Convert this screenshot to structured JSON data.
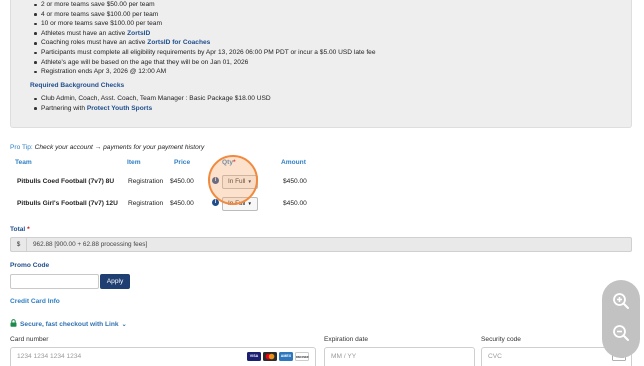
{
  "discounts": [
    {
      "text": "2 or more teams save $50.00 per team"
    },
    {
      "text": "4 or more teams save $100.00 per team"
    },
    {
      "text": "10 or more teams save $100.00 per team"
    }
  ],
  "requirements": {
    "athletes": {
      "text": "Athletes must have an active ",
      "link": "ZortsID"
    },
    "coaching": {
      "text": "Coaching roles must have an active ",
      "link": "ZortsID for Coaches"
    },
    "eligibility": "Participants must complete all eligibility requirements by Apr 13, 2026 06:00 PM PDT or incur a $5.00 USD late fee",
    "age": "Athlete's age will be based on the age that they will be on Jan 01, 2026",
    "reg_ends": "Registration ends Apr 3, 2026 @ 12:00 AM"
  },
  "background_checks": {
    "heading": "Required Background Checks",
    "package": "Club Admin, Coach, Asst. Coach, Team Manager : Basic Package $18.00 USD",
    "partner_text": "Partnering with ",
    "partner_link": "Protect Youth Sports"
  },
  "pro_tip": {
    "label": "Pro Tip:",
    "text": "Check your account → payments for your payment history"
  },
  "table": {
    "headers": {
      "team": "Team",
      "item": "Item",
      "price": "Price",
      "qty": "Qty",
      "qty_star": "*",
      "amount": "Amount"
    },
    "rows": [
      {
        "team": "Pitbulls Coed Football (7v7) 8U",
        "item": "Registration",
        "price": "$450.00",
        "qty": "In Full",
        "amount": "$450.00"
      },
      {
        "team": "Pitbulls Girl's Football (7v7) 12U",
        "item": "Registration",
        "price": "$450.00",
        "qty": "In Full",
        "amount": "$450.00"
      }
    ],
    "info_glyph": "i"
  },
  "total": {
    "label": "Total",
    "star": "*",
    "currency": "$",
    "value": "962.88 [900.00 + 62.88 processing fees]"
  },
  "promo": {
    "label": "Promo Code",
    "value": "",
    "apply_label": "Apply"
  },
  "credit_card": {
    "heading": "Credit Card Info",
    "link_text": "Secure, fast checkout with Link",
    "card_number_label": "Card number",
    "card_number_placeholder": "1234 1234 1234 1234",
    "expiration_label": "Expiration date",
    "expiration_placeholder": "MM / YY",
    "security_label": "Security code",
    "security_placeholder": "CVC",
    "brands": [
      "VISA",
      "",
      "AMEX",
      "DISCOVER"
    ]
  },
  "icons": {
    "zoom_in": "zoom-in-icon",
    "zoom_out": "zoom-out-icon",
    "lock": "lock-icon",
    "info": "info-icon",
    "cvc": "cvc-card-icon"
  },
  "colors": {
    "heading_blue": "#1f4e8c",
    "link_blue": "#2f7fc3",
    "apply_button": "#1f3f73",
    "link_green": "#1e8a4c",
    "highlight": "#f08a3e",
    "required": "#d0021b"
  }
}
